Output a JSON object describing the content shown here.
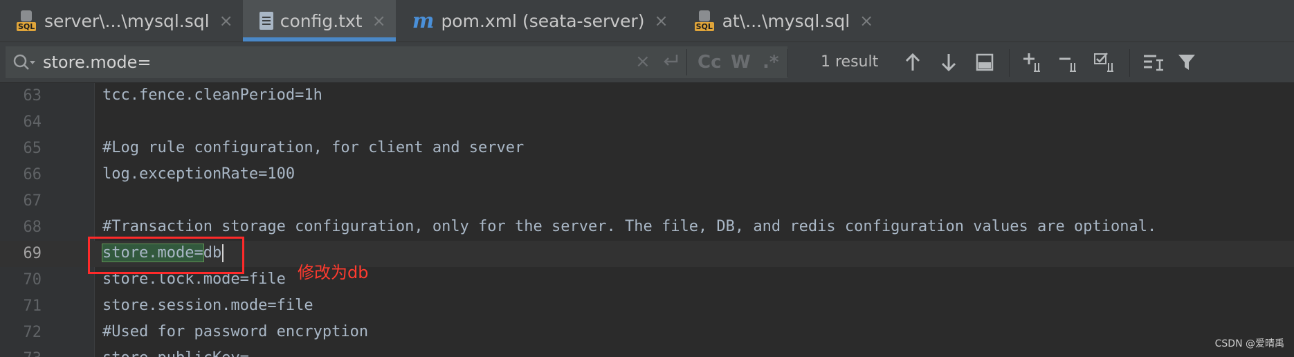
{
  "tabs": [
    {
      "label": "server\\...\\mysql.sql",
      "icon": "sql-file-icon",
      "active": false
    },
    {
      "label": "config.txt",
      "icon": "text-file-icon",
      "active": true
    },
    {
      "label": "pom.xml (seata-server)",
      "icon": "maven-icon",
      "active": false
    },
    {
      "label": "at\\...\\mysql.sql",
      "icon": "sql-file-icon",
      "active": false
    }
  ],
  "tab_close_glyph": "×",
  "search": {
    "query": "store.mode=",
    "result_count": "1 result",
    "options": {
      "match_case": "Cc",
      "words": "W",
      "regex": ".*"
    }
  },
  "editor": {
    "lines": [
      {
        "num": "63",
        "text": "tcc.fence.cleanPeriod=1h"
      },
      {
        "num": "64",
        "text": ""
      },
      {
        "num": "65",
        "text": "#Log rule configuration, for client and server"
      },
      {
        "num": "66",
        "text": "log.exceptionRate=100"
      },
      {
        "num": "67",
        "text": ""
      },
      {
        "num": "68",
        "text": "#Transaction storage configuration, only for the server. The file, DB, and redis configuration values are optional."
      },
      {
        "num": "69",
        "match": "store.mode=",
        "rest": "db"
      },
      {
        "num": "70",
        "text": "store.lock.mode=file"
      },
      {
        "num": "71",
        "text": "store.session.mode=file"
      },
      {
        "num": "72",
        "text": "#Used for password encryption"
      },
      {
        "num": "73",
        "text": "store.publicKey="
      }
    ],
    "annotation": "修改为db"
  },
  "watermark": "CSDN @爱晴禹",
  "colors": {
    "accent": "#4a88c7",
    "annotation": "#ff2a2a",
    "match_highlight": "#32593d"
  }
}
